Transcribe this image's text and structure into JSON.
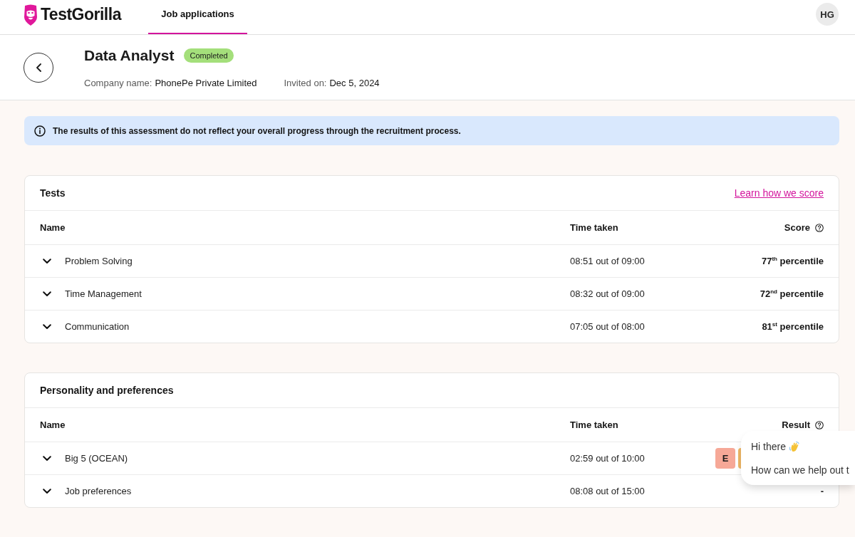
{
  "nav": {
    "logo": "TestGorilla",
    "tabs": [
      {
        "label": "Job applications",
        "selected": true
      }
    ],
    "avatar": "HG"
  },
  "assessment": {
    "title": "Data Analyst",
    "status": "Completed",
    "meta": [
      {
        "label": "Company name:",
        "value": "PhonePe Private Limited"
      },
      {
        "label": "Invited on:",
        "value": "Dec 5, 2024"
      }
    ]
  },
  "notice": "The results of this assessment do not reflect your overall progress through the recruitment process.",
  "tests": {
    "title": "Tests",
    "link": "Learn how we score",
    "columns": [
      {
        "label": "Name",
        "help": false
      },
      {
        "label": "Time taken",
        "help": false
      },
      {
        "label": "Score",
        "help": true
      }
    ],
    "rows": [
      {
        "name": "Problem Solving",
        "time": "08:51 out of 09:00",
        "score": "77$^{th}$ percentile",
        "expanded": false
      },
      {
        "name": "Time Management",
        "time": "08:32 out of 09:00",
        "score": "72$^{nd}$ percentile",
        "expanded": false
      },
      {
        "name": "Communication",
        "time": "07:05 out of 08:00",
        "score": "81$^{st}$ percentile",
        "expanded": false
      }
    ]
  },
  "personality": {
    "title": "Personality and preferences",
    "columns": [
      {
        "label": "Name",
        "help": false
      },
      {
        "label": "Time taken",
        "help": false
      },
      {
        "label": "Result",
        "help": true
      }
    ],
    "rows": [
      {
        "name": "Big 5 (OCEAN)",
        "time": "02:59 out of 10:00",
        "expanded": false,
        "result_tiles": [
          {
            "label": "E",
            "color": "#f6a897"
          },
          {
            "color": "#efb766"
          }
        ]
      },
      {
        "name": "Job preferences",
        "time": "08:08 out of 15:00",
        "expanded": false,
        "score": "-"
      }
    ]
  },
  "chat": {
    "greeting": "Hi there",
    "prompt": "How can we help out t"
  }
}
